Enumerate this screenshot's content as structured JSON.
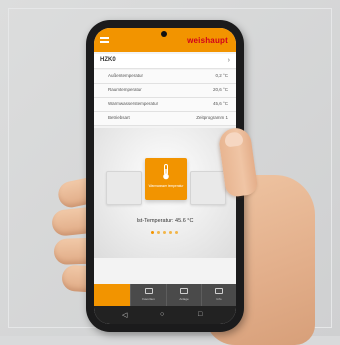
{
  "app": {
    "brand": "weishaupt",
    "device_name": "HZK0"
  },
  "readings": [
    {
      "label": "Außentemperatur",
      "value": "0,2 °C"
    },
    {
      "label": "Raumtemperatur",
      "value": "20,6 °C"
    },
    {
      "label": "Warmwasserstemperatur",
      "value": "45,6 °C"
    },
    {
      "label": "Betriebsart",
      "value": "Zeitprogramm 1"
    }
  ],
  "card": {
    "caption": "Warmwasser temperatur"
  },
  "ist_temperature": "Ist-Temperatur: 45.6 °C",
  "nav": {
    "items": [
      {
        "label": ""
      },
      {
        "label": "Favoriten"
      },
      {
        "label": "Anlage"
      },
      {
        "label": "Info"
      }
    ]
  },
  "colors": {
    "accent": "#f29400",
    "brand": "#d1001c"
  },
  "icons": {
    "menu": "menu-icon",
    "chevron": "chevron-right-icon",
    "thermometer": "thermometer-icon"
  }
}
